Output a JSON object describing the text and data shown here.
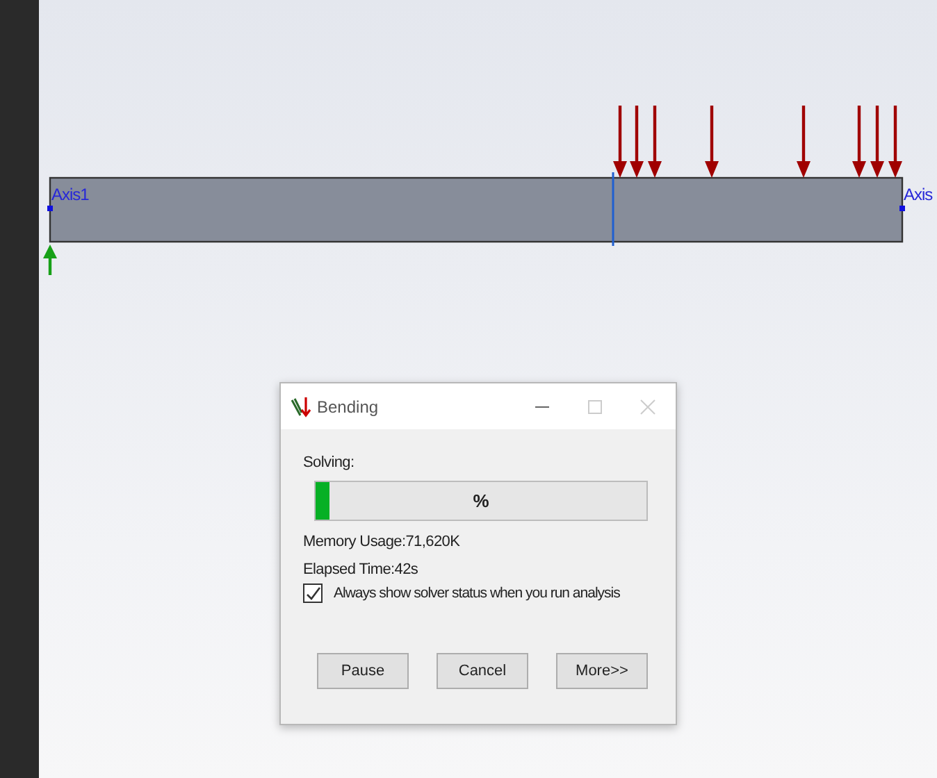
{
  "canvas": {
    "axis_labels": [
      "Axis1",
      "Axis"
    ]
  },
  "dialog": {
    "title": "Bending",
    "status_label": "Solving:",
    "progress": {
      "level": 0.04,
      "text": "%"
    },
    "memory": "Memory Usage:71,620K",
    "elapsed": "Elapsed Time:42s",
    "checkbox": {
      "label": "Always show solver status when you run analysis",
      "checked": true
    },
    "buttons": [
      "Pause",
      "Cancel",
      "More>>"
    ]
  }
}
